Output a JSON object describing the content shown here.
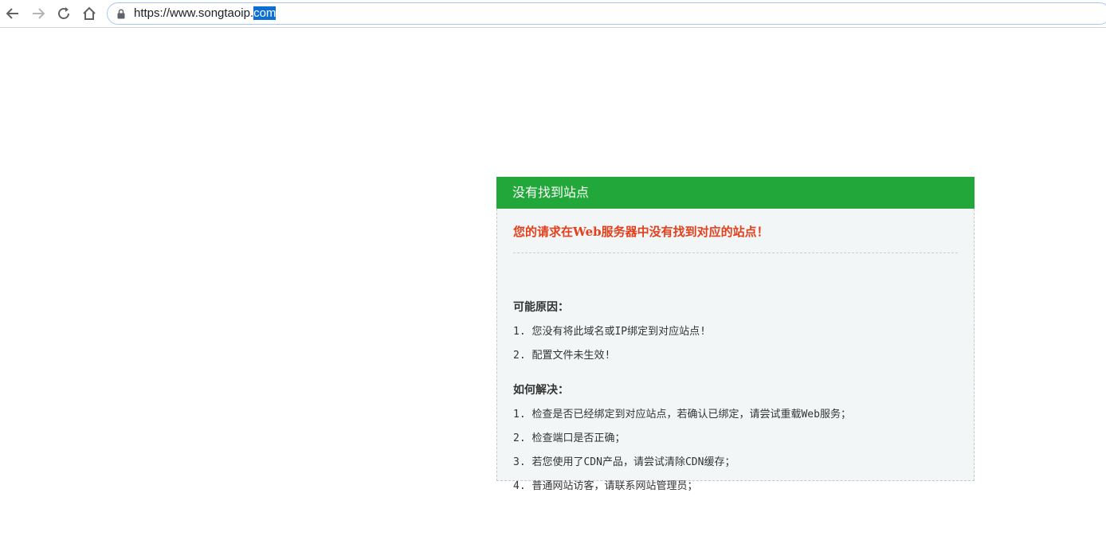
{
  "browser": {
    "url_main": "https://www.songtaoip.",
    "url_selected": "com",
    "nav": {
      "back_icon": "arrow-left-icon",
      "forward_icon": "arrow-right-icon",
      "reload_icon": "reload-icon",
      "home_icon": "home-icon",
      "lock_icon": "lock-icon"
    }
  },
  "card": {
    "header": "没有找到站点",
    "error_message": "您的请求在Web服务器中没有找到对应的站点！",
    "reasons_title": "可能原因：",
    "reasons": [
      "1. 您没有将此域名或IP绑定到对应站点!",
      "2. 配置文件未生效!"
    ],
    "solutions_title": "如何解决：",
    "solutions": [
      "1. 检查是否已经绑定到对应站点，若确认已绑定，请尝试重载Web服务；",
      "2. 检查端口是否正确；",
      "3. 若您使用了CDN产品，请尝试清除CDN缓存；",
      "4. 普通网站访客，请联系网站管理员；"
    ]
  },
  "colors": {
    "header_green": "#22a73a",
    "error_red": "#e33f1b",
    "body_bg": "#f3f6f7",
    "selection_blue": "#0c6fd3"
  }
}
